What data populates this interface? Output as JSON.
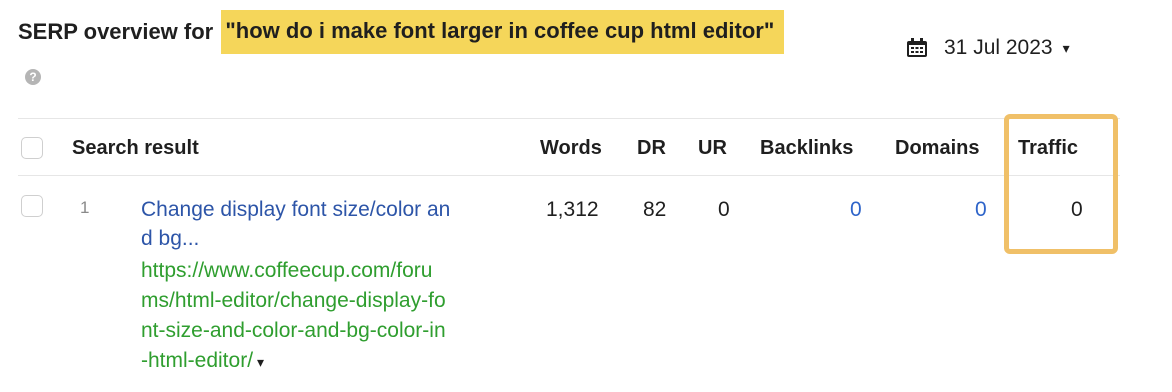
{
  "header": {
    "title_prefix": "SERP overview for ",
    "query": "\"how do i make font larger in coffee cup html editor\"",
    "help_icon": "question-circle-icon",
    "help_glyph": "?"
  },
  "date_picker": {
    "icon": "calendar-icon",
    "value": "31 Jul 2023",
    "caret": "▾"
  },
  "table": {
    "columns": {
      "search_result": "Search result",
      "words": "Words",
      "dr": "DR",
      "ur": "UR",
      "backlinks": "Backlinks",
      "domains": "Domains",
      "traffic": "Traffic"
    },
    "rows": [
      {
        "rank": "1",
        "title_line1": "Change display font size/color an",
        "title_line2": "d bg...",
        "url_lines": [
          "https://www.coffeecup.com/foru",
          "ms/html-editor/change-display-fo",
          "nt-size-and-color-and-bg-color-in",
          "-html-editor/"
        ],
        "url_caret": "▾",
        "words": "1,312",
        "dr": "82",
        "ur": "0",
        "backlinks": "0",
        "domains": "0",
        "traffic": "0"
      }
    ]
  },
  "colors": {
    "highlight": "#f5d65a",
    "traffic_outline": "#f0c068",
    "link": "#2d55a8",
    "url": "#2f9e2f"
  }
}
